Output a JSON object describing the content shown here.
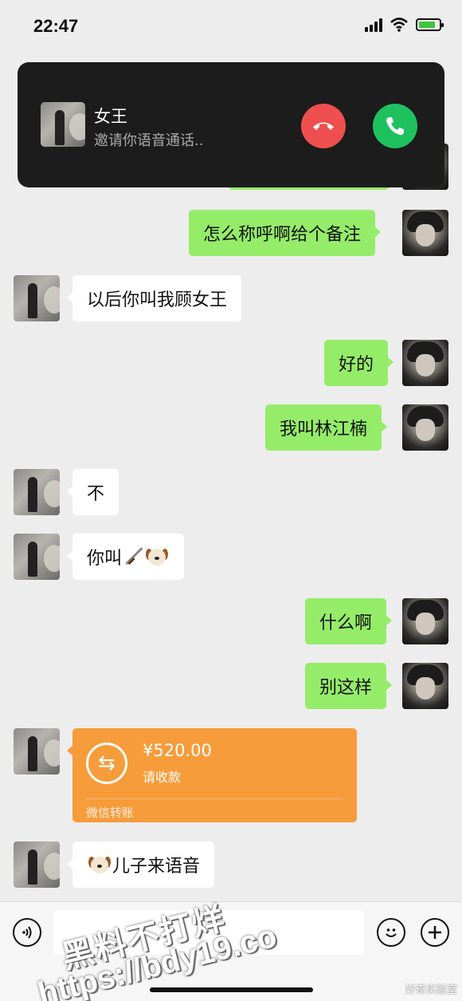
{
  "status_bar": {
    "time": "22:47"
  },
  "call": {
    "name": "女王",
    "subtitle": "邀请你语音通话..",
    "decline_icon": "phone-hangup-icon",
    "accept_icon": "phone-answer-icon"
  },
  "messages": [
    {
      "side": "right",
      "text": "怎么称呼啊给个备注"
    },
    {
      "side": "left",
      "text": "以后你叫我顾女王"
    },
    {
      "side": "right",
      "text": "好的"
    },
    {
      "side": "right",
      "text": "我叫林江楠"
    },
    {
      "side": "left",
      "text": "不"
    },
    {
      "side": "left",
      "text": "你叫",
      "emoji": [
        "dagger",
        "dog-face"
      ]
    },
    {
      "side": "right",
      "text": "什么啊"
    },
    {
      "side": "right",
      "text": "别这样"
    },
    {
      "side": "left",
      "text": "儿子来语音",
      "emoji_before": "dog-face"
    }
  ],
  "transfer": {
    "amount": "¥520.00",
    "status": "请收款",
    "footer": "微信转账",
    "icon": "transfer-arrows-icon"
  },
  "input_bar": {
    "voice_icon": "voice-icon",
    "emoji_icon": "emoji-icon",
    "plus_icon": "plus-icon"
  },
  "watermark": {
    "line1": "黑料不打烊",
    "line2": "https://bdy19.co",
    "corner": "好奇实验室"
  }
}
